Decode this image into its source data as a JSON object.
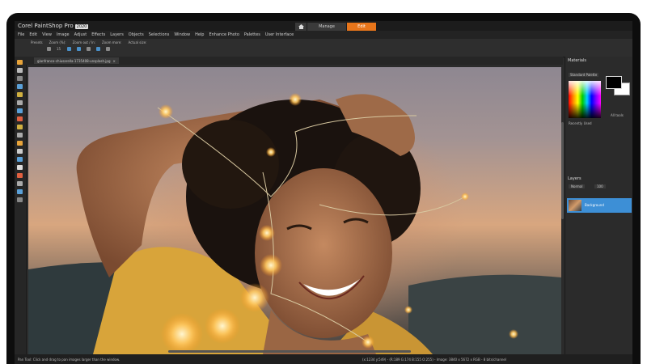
{
  "app": {
    "title": "Corel PaintShop Pro",
    "version": "2020"
  },
  "workspace_tabs": [
    {
      "label": "Manage",
      "active": false
    },
    {
      "label": "Edit",
      "active": true
    }
  ],
  "menu": [
    "File",
    "Edit",
    "View",
    "Image",
    "Adjust",
    "Effects",
    "Layers",
    "Objects",
    "Selections",
    "Window",
    "Help",
    "Enhance Photo",
    "Palettes",
    "User Interface"
  ],
  "toolbar": {
    "labels": [
      "Presets",
      "Zoom (%):",
      "Zoom out / In:",
      "Zoom more:",
      "Actual size:"
    ],
    "zoom_value": "15"
  },
  "document": {
    "tab_title": "gianfranco-chiusarella-1735408-unsplash.jpg"
  },
  "materials": {
    "title": "Materials",
    "palette": "Standard Palette",
    "recently_used": "Recently Used",
    "all_tools": "All tools"
  },
  "layers": {
    "title": "Layers",
    "blend_mode": "Normal",
    "opacity": "100",
    "layer_name": "Background"
  },
  "status": {
    "left": "Pan Tool: Click and drag to pan images larger than the window.",
    "right": "(x:1234 y:549) - (R:189 G:174 B:155 O:255)  - Image: 3840 x 5672 x RGB - 8 bits/channel"
  },
  "colors": {
    "accent": "#e8751a",
    "layer_selected": "#3d8fd6"
  }
}
